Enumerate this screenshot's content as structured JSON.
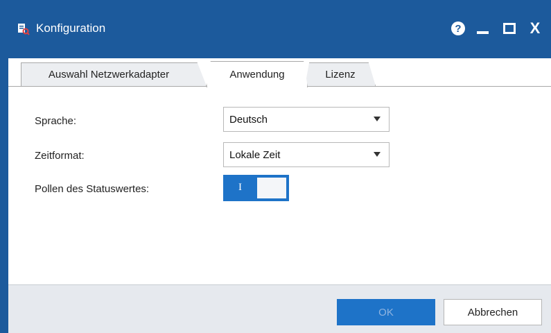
{
  "window": {
    "title": "Konfiguration",
    "app_icon": "config-magnifier-icon",
    "controls": {
      "help": "?",
      "close": "X"
    }
  },
  "tabs": [
    {
      "label": "Auswahl Netzwerkadapter",
      "active": false
    },
    {
      "label": "Anwendung",
      "active": true
    },
    {
      "label": "Lizenz",
      "active": false
    }
  ],
  "form": {
    "language": {
      "label": "Sprache:",
      "value": "Deutsch"
    },
    "timeformat": {
      "label": "Zeitformat:",
      "value": "Lokale Zeit"
    },
    "polling": {
      "label": "Pollen des Statuswertes:",
      "toggle_text": "I",
      "on": true
    }
  },
  "footer": {
    "ok_label": "OK",
    "cancel_label": "Abbrechen"
  },
  "colors": {
    "titlebar": "#1c5a9c",
    "accent": "#1e73c8",
    "footer": "#e6e9ee"
  }
}
